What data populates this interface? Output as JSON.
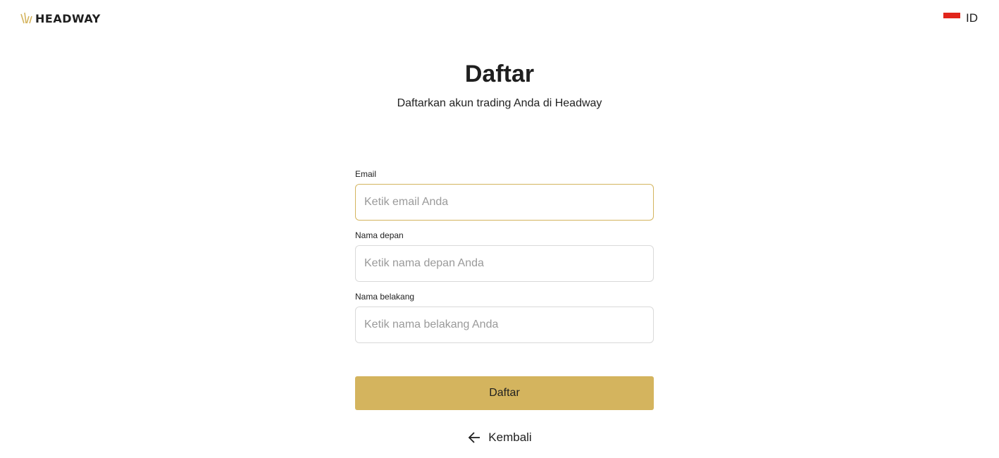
{
  "header": {
    "logo_text": "HEADWAY",
    "language_code": "ID",
    "colors": {
      "brand_gold": "#d4b45e",
      "flag_red": "#e1251b"
    }
  },
  "main": {
    "title": "Daftar",
    "subtitle": "Daftarkan akun trading Anda di Headway"
  },
  "form": {
    "email": {
      "label": "Email",
      "placeholder": "Ketik email Anda",
      "value": ""
    },
    "first_name": {
      "label": "Nama depan",
      "placeholder": "Ketik nama depan Anda",
      "value": ""
    },
    "last_name": {
      "label": "Nama belakang",
      "placeholder": "Ketik nama belakang Anda",
      "value": ""
    },
    "submit_label": "Daftar"
  },
  "footer": {
    "back_label": "Kembali",
    "back_icon": "arrow-left-icon"
  }
}
